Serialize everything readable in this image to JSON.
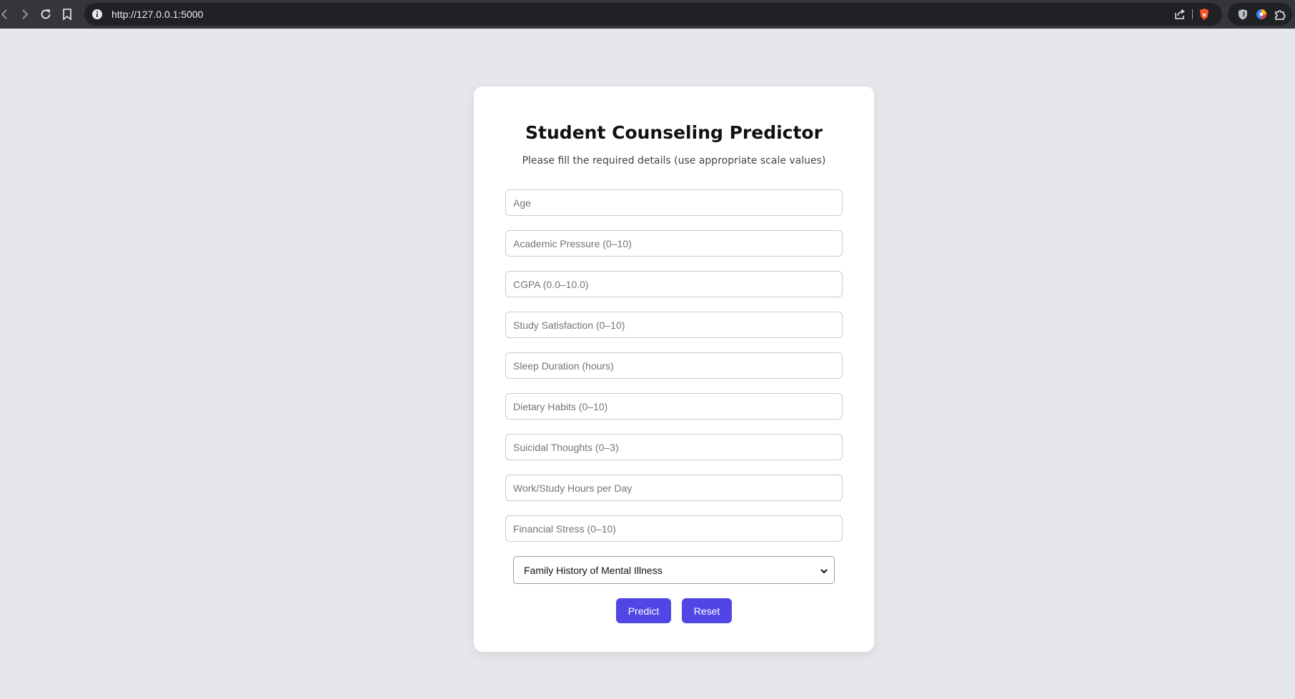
{
  "browser": {
    "url": "http://127.0.0.1:5000"
  },
  "form": {
    "title": "Student Counseling Predictor",
    "subtitle": "Please fill the required details (use appropriate scale values)",
    "fields": [
      {
        "placeholder": "Age",
        "value": ""
      },
      {
        "placeholder": "Academic Pressure (0–10)",
        "value": ""
      },
      {
        "placeholder": "CGPA (0.0–10.0)",
        "value": ""
      },
      {
        "placeholder": "Study Satisfaction (0–10)",
        "value": ""
      },
      {
        "placeholder": "Sleep Duration (hours)",
        "value": ""
      },
      {
        "placeholder": "Dietary Habits (0–10)",
        "value": ""
      },
      {
        "placeholder": "Suicidal Thoughts (0–3)",
        "value": ""
      },
      {
        "placeholder": "Work/Study Hours per Day",
        "value": ""
      },
      {
        "placeholder": "Financial Stress (0–10)",
        "value": ""
      }
    ],
    "select": {
      "selected": "Family History of Mental Illness"
    },
    "predict_label": "Predict",
    "reset_label": "Reset"
  },
  "colors": {
    "accent": "#4f46e5",
    "page_background": "#e5e7eb",
    "card_background": "#ffffff"
  },
  "icons": {
    "toolbar": [
      "back-icon",
      "forward-icon",
      "reload-icon",
      "bookmark-icon"
    ],
    "urlbar": [
      "info-icon",
      "share-icon",
      "brave-shield-icon"
    ],
    "extensions": [
      "shield-extension-icon",
      "color-extension-icon",
      "puzzle-icon"
    ]
  }
}
